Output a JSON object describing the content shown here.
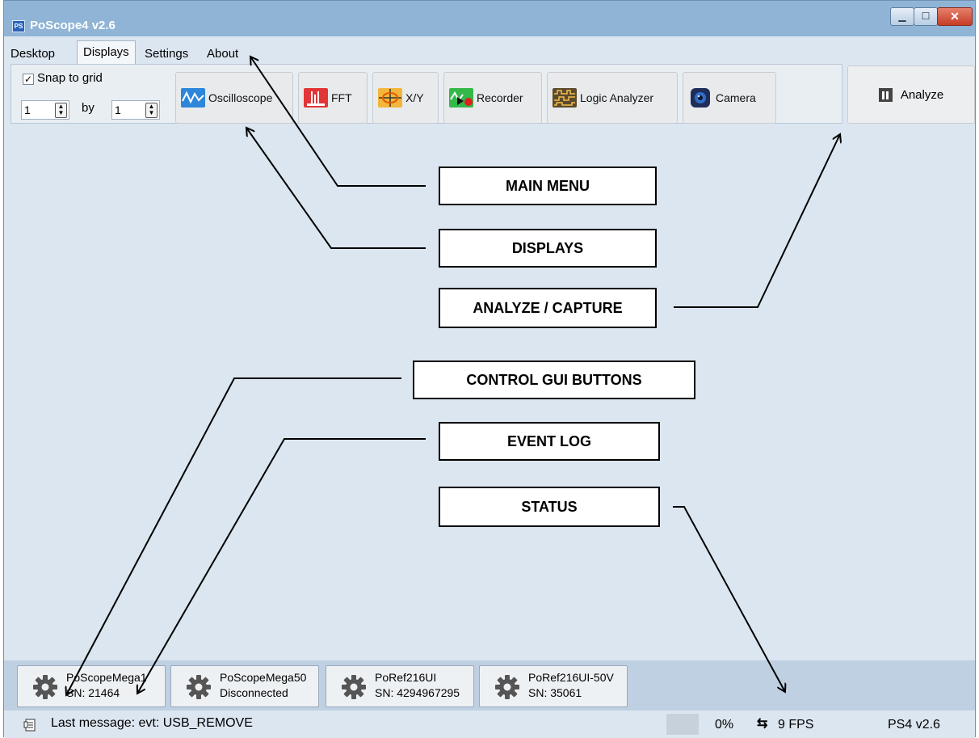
{
  "window": {
    "title": "PoScope4 v2.6",
    "app_icon": "oscilloscope-icon"
  },
  "window_controls": {
    "minimize": "▁",
    "maximize": "☐",
    "close": "✕"
  },
  "menu": {
    "tabs": [
      {
        "label": "Desktop"
      },
      {
        "label": "Displays"
      },
      {
        "label": "Settings"
      },
      {
        "label": "About"
      }
    ],
    "active_tab": "Displays"
  },
  "toolbar": {
    "snap_label": "Snap to grid",
    "snap_checked": true,
    "grid_x": "1",
    "grid_by": "by",
    "grid_y": "1",
    "displays": [
      {
        "label": "Oscilloscope",
        "icon": "oscilloscope-icon"
      },
      {
        "label": "FFT",
        "icon": "fft-icon"
      },
      {
        "label": "X/Y",
        "icon": "xy-icon"
      },
      {
        "label": "Recorder",
        "icon": "recorder-icon"
      },
      {
        "label": "Logic Analyzer",
        "icon": "logic-analyzer-icon"
      },
      {
        "label": "Camera",
        "icon": "camera-icon"
      }
    ],
    "analyze_label": "Analyze",
    "analyze_icon": "pause-icon"
  },
  "callouts": {
    "main_menu": "MAIN MENU",
    "displays": "DISPLAYS",
    "analyze": "ANALYZE / CAPTURE",
    "control": "CONTROL GUI BUTTONS",
    "event_log": "EVENT LOG",
    "status": "STATUS"
  },
  "devices": [
    {
      "name": "PoScopeMega1",
      "sub": "SN: 21464",
      "icon": "gear-icon"
    },
    {
      "name": "PoScopeMega50",
      "sub": "Disconnected",
      "icon": "gear-icon"
    },
    {
      "name": "PoRef216UI",
      "sub": "SN: 4294967295",
      "icon": "gear-icon"
    },
    {
      "name": "PoRef216UI-50V",
      "sub": "SN: 35061",
      "icon": "gear-icon"
    }
  ],
  "status": {
    "message": "Last message: evt: USB_REMOVE",
    "percent": "0%",
    "fps": "9 FPS",
    "version": "PS4 v2.6"
  }
}
